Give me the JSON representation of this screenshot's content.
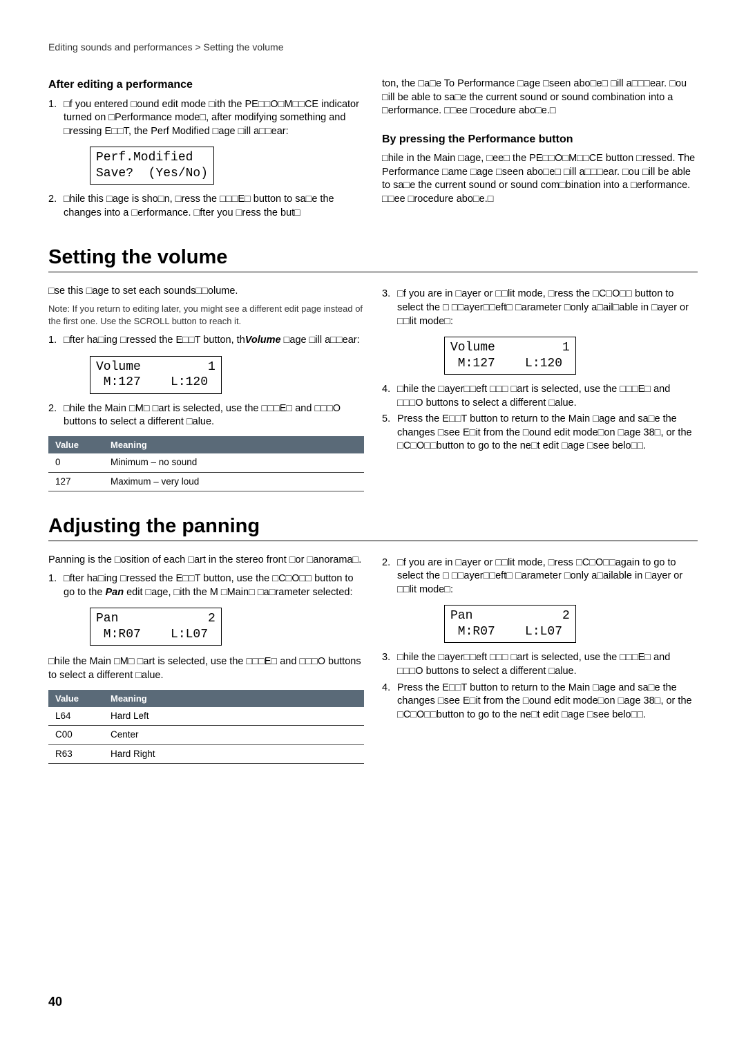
{
  "breadcrumb": "Editing sounds and performances    > Setting the volume",
  "page_number": "40",
  "top": {
    "left": {
      "heading": "After editing a performance",
      "step1": "□f you entered □ound edit mode □ith the PE□□O□M□□CE indicator turned on □Performance mode□, after modifying something and □ressing E□□T, the Perf Modified □age □ill a□□ear:",
      "lcd": "Perf.Modified\nSave?  (Yes/No)",
      "step2": "□hile this □age is sho□n, □ress the □□□E□ button to sa□e the changes into a □erformance. □fter you □ress the but□"
    },
    "right": {
      "para1": "ton, the □a□e To Performance □age □seen abo□e□ □ill a□□□ear. □ou □ill be able to sa□e the current sound or sound combination into a □erformance. □□ee □rocedure abo□e.□",
      "heading": "By pressing the Performance button",
      "para2": "□hile in the Main □age, □ee□ the PE□□O□M□□CE button □ressed. The Performance □ame □age □seen abo□e□ □ill a□□□ear. □ou □ill be able to sa□e the current sound or sound com□bination into a □erformance. □□ee □rocedure abo□e.□"
    }
  },
  "volume": {
    "heading": "Setting the volume",
    "left": {
      "intro": "□se this □age to set each sounds□□olume.",
      "note": "Note: If you return to editing later, you might see a different edit page instead of the first one. Use the SCROLL       button to reach it.",
      "step1_a": "□fter ha□ing □ressed the E□□T button, th",
      "step1_i": "Volume",
      "step1_b": " □age □ill a□□ear:",
      "lcd": "Volume         1\n M:127    L:120",
      "step2": "□hile the Main □M□ □art is selected, use the □□□E□ and □□□O buttons to select a different □alue.",
      "table": {
        "h1": "Value",
        "h2": "Meaning",
        "r1v": "0",
        "r1m": "Minimum – no sound",
        "r2v": "127",
        "r2m": "Maximum – very loud"
      }
    },
    "right": {
      "step3": "□f you are in □ayer or □□lit mode, □ress the □C□O□□ button to select the □ □□ayer□□eft□ □arameter □only a□ail□able in □ayer or □□lit mode□:",
      "lcd": "Volume         1\n M:127    L:120",
      "step4": "□hile the □ayer□□eft □□□ □art is selected, use the □□□E□ and □□□O buttons to select a different □alue.",
      "step5": "Press the E□□T button to return to the Main □age and sa□e the changes □see E□it from the □ound edit mode□on □age 38□, or the □C□O□□button to go to the ne□t edit □age □see belo□□."
    }
  },
  "panning": {
    "heading": "Adjusting the panning",
    "left": {
      "intro": "Panning is the □osition of each □art in the stereo front □or □anorama□.",
      "step1_a": "□fter ha□ing □ressed the E□□T button, use the □C□O□□ button to go to the ",
      "step1_i": "Pan",
      "step1_b": " edit □age, □ith the M □Main□ □a□rameter selected:",
      "lcd": "Pan            2\n M:R07    L:L07",
      "after": "□hile the Main □M□ □art is selected, use the □□□E□ and □□□O buttons to select a different □alue.",
      "table": {
        "h1": "Value",
        "h2": "Meaning",
        "r1v": "L64",
        "r1m": "Hard Left",
        "r2v": "C00",
        "r2m": "Center",
        "r3v": "R63",
        "r3m": "Hard Right"
      }
    },
    "right": {
      "step2": "□f you are in □ayer or □□lit mode, □ress □C□O□□again to go to select the □ □□ayer□□eft□ □arameter □only a□ailable in □ayer or □□lit mode□:",
      "lcd": "Pan            2\n M:R07    L:L07",
      "step3": "□hile the □ayer□□eft □□□ □art is selected, use the □□□E□ and □□□O buttons to select a different □alue.",
      "step4": "Press the E□□T button to return to the Main □age and sa□e the changes □see E□it from the □ound edit mode□on □age 38□, or the □C□O□□button to go to the ne□t edit □age □see belo□□."
    }
  }
}
